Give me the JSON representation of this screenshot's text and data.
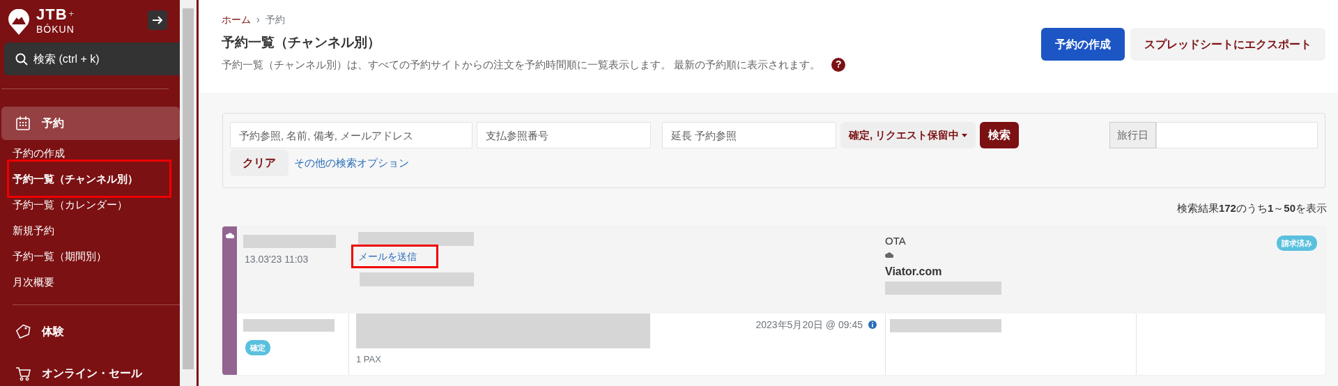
{
  "sidebar": {
    "logo": {
      "brand": "JTB",
      "plus": "+",
      "sub": "BÓKUN"
    },
    "search": {
      "label": "検索 (ctrl + k)"
    },
    "groups": [
      {
        "label": "予約",
        "kind": "calendar",
        "selected": true,
        "children": [
          {
            "label": "予約の作成",
            "selected": false,
            "highlighted": false
          },
          {
            "label": "予約一覧（チャンネル別）",
            "selected": true,
            "highlighted": true
          },
          {
            "label": "予約一覧（カレンダー）",
            "selected": false,
            "highlighted": false
          },
          {
            "label": "新規予約",
            "selected": false,
            "highlighted": false
          },
          {
            "label": "予約一覧（期間別）",
            "selected": false,
            "highlighted": false
          },
          {
            "label": "月次概要",
            "selected": false,
            "highlighted": false
          }
        ]
      },
      {
        "label": "体験",
        "kind": "tag",
        "selected": false
      },
      {
        "label": "オンライン・セール",
        "kind": "cart",
        "selected": false
      }
    ]
  },
  "breadcrumb": [
    {
      "label": "ホーム",
      "link": true
    },
    {
      "label": "予約",
      "link": false
    }
  ],
  "separator": "›",
  "title": "予約一覧（チャンネル別）",
  "description": "予約一覧（チャンネル別）は、すべての予約サイトからの注文を予約時間順に一覧表示します。 最新の予約順に表示されます。",
  "help": "?",
  "actions": [
    {
      "label": "予約の作成",
      "kind": "primary"
    },
    {
      "label": "スプレッドシートにエクスポート",
      "kind": "secondary"
    }
  ],
  "filters": {
    "fields": [
      {
        "placeholder": "予約参照, 名前, 備考, メールアドレス"
      },
      {
        "placeholder": "支払参照番号"
      },
      {
        "placeholder": "延長 予約参照"
      }
    ],
    "status_dropdown": "確定, リクエスト保留中",
    "search_button": "検索",
    "date_label": "旅行日",
    "clear_button": "クリア",
    "more_options": "その他の検索オプション"
  },
  "results": "検索結果**172**のうち**1**～**50**を表示",
  "bookings": [
    {
      "created": "13.03'23 11:03",
      "send_mail": "メールを送信",
      "send_mail_highlighted": true,
      "channel_type": "OTA",
      "channel": "Viator.com",
      "payment_badge": "請求済み",
      "status_badge": "確定",
      "date": "2023年5月20日 @ 09:45",
      "pax": "1 PAX"
    }
  ]
}
